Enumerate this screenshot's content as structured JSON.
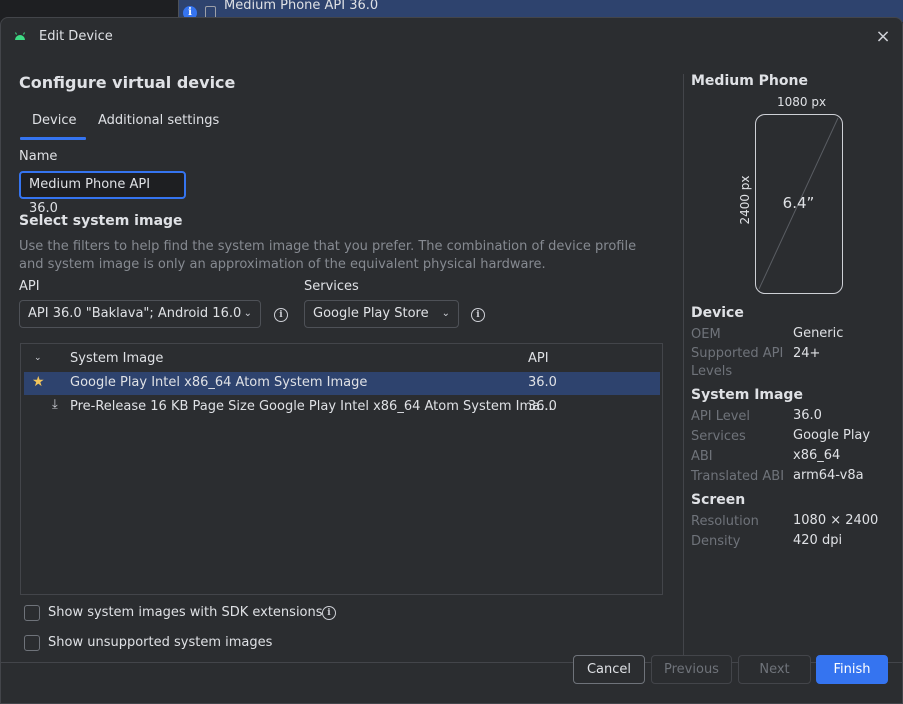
{
  "background": {
    "title": "Medium Phone API 36.0",
    "info_icon": "i"
  },
  "dialog": {
    "title": "Edit Device",
    "close_icon": "×",
    "heading": "Configure virtual device",
    "tabs": [
      {
        "label": "Device",
        "active": true
      },
      {
        "label": "Additional settings",
        "active": false
      }
    ],
    "name_label": "Name",
    "name_value": "Medium Phone API 36.0",
    "system_image_heading": "Select system image",
    "help_text": "Use the filters to help find the system image that you prefer. The combination of device profile and system image is only an approximation of the equivalent physical hardware.",
    "api_label": "API",
    "api_selected": "API 36.0 \"Baklava\"; Android 16.0",
    "services_label": "Services",
    "services_selected": "Google Play Store",
    "info_glyph": "i",
    "chevron": "⌄",
    "table": {
      "headers": {
        "system_image": "System Image",
        "api": "API"
      },
      "sort_icon": "⌄",
      "rows": [
        {
          "icon": "star-icon",
          "icon_glyph": "★",
          "name": "Google Play Intel x86_64 Atom System Image",
          "api": "36.0",
          "selected": true
        },
        {
          "icon": "download-icon",
          "icon_glyph": "⤓",
          "name": "Pre-Release 16 KB Page Size Google Play Intel x86_64 Atom System Ima...",
          "api": "36.0",
          "selected": false
        }
      ]
    },
    "checkboxes": {
      "sdk_extensions": {
        "label": "Show system images with SDK extensions",
        "checked": false
      },
      "unsupported": {
        "label": "Show unsupported system images",
        "checked": false
      }
    },
    "buttons": {
      "cancel": "Cancel",
      "previous": "Previous",
      "next": "Next",
      "finish": "Finish"
    }
  },
  "preview": {
    "title": "Medium Phone",
    "width_label": "1080 px",
    "height_label": "2400 px",
    "size_label": "6.4”",
    "device_heading": "Device",
    "device_specs": {
      "oem_key": "OEM",
      "oem_val": "Generic",
      "api_levels_key": "Supported API Levels",
      "api_levels_val": "24+"
    },
    "system_image_heading": "System Image",
    "system_image_specs": {
      "api_level_key": "API Level",
      "api_level_val": "36.0",
      "services_key": "Services",
      "services_val": "Google Play",
      "abi_key": "ABI",
      "abi_val": "x86_64",
      "translated_abi_key": "Translated ABI",
      "translated_abi_val": "arm64-v8a"
    },
    "screen_heading": "Screen",
    "screen_specs": {
      "resolution_key": "Resolution",
      "resolution_val": "1080 × 2400",
      "density_key": "Density",
      "density_val": "420 dpi"
    }
  },
  "colors": {
    "accent": "#3574f0",
    "background": "#2b2d30",
    "selected_row": "#2e436e",
    "star": "#f2c55c"
  }
}
